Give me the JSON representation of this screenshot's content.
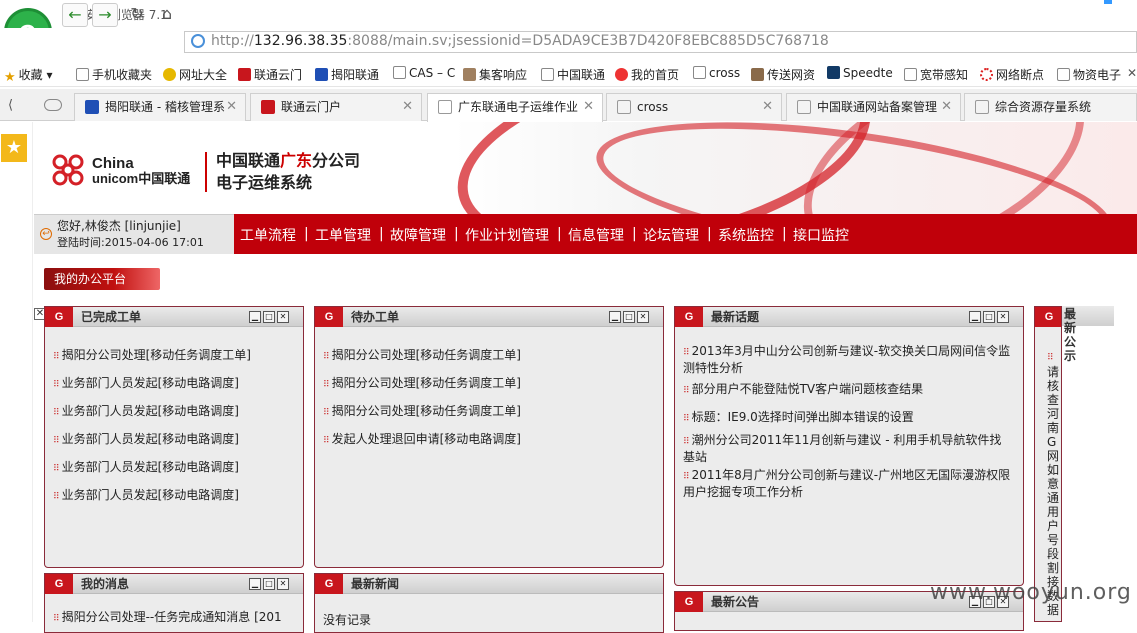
{
  "browser": {
    "app_title": "360安全浏览器 7.1",
    "url_prefix": "http://",
    "url_host": "132.96.38.35",
    "url_rest": ":8088/main.sv;jsessionid=D5ADA9CE3B7D420F8EBC885D5C768718"
  },
  "bookmarks": [
    {
      "label": "收藏",
      "icon": "star-icon"
    },
    {
      "label": "手机收藏夹",
      "icon": "page-icon"
    },
    {
      "label": "网址大全",
      "icon": "globe-icon"
    },
    {
      "label": "联通云门",
      "icon": "unicom-icon"
    },
    {
      "label": "揭阳联通",
      "icon": "unicom-icon"
    },
    {
      "label": "CAS – C",
      "icon": "page-icon"
    },
    {
      "label": "集客响应",
      "icon": "image-icon"
    },
    {
      "label": "中国联通",
      "icon": "page-icon"
    },
    {
      "label": "我的首页",
      "icon": "weibo-icon"
    },
    {
      "label": "cross",
      "icon": "page-icon"
    },
    {
      "label": "传送网资",
      "icon": "image-icon"
    },
    {
      "label": "Speedte",
      "icon": "speedtest-icon"
    },
    {
      "label": "宽带感知",
      "icon": "page-icon"
    },
    {
      "label": "网络断点",
      "icon": "spinner-icon"
    },
    {
      "label": "物资电子",
      "icon": "page-icon"
    }
  ],
  "tabs": [
    {
      "label": "揭阳联通 - 稽核管理系"
    },
    {
      "label": "联通云门户"
    },
    {
      "label": "广东联通电子运维作业"
    },
    {
      "label": "cross"
    },
    {
      "label": "中国联通网站备案管理"
    },
    {
      "label": "综合资源存量系统"
    }
  ],
  "header": {
    "brand_line1": "China",
    "brand_line2": "unicom中国联通",
    "title_part1": "中国联通",
    "title_red": "广东",
    "title_part2": "分公司",
    "title_line2": "电子运维系统"
  },
  "user": {
    "greeting": "您好,林俊杰 [linjunjie]",
    "login_time": "登陆时间:2015-04-06 17:01"
  },
  "menu": [
    "工单流程",
    "工单管理",
    "故障管理",
    "作业计划管理",
    "信息管理",
    "论坛管理",
    "系统监控",
    "接口监控"
  ],
  "office_label": "我的办公平台",
  "panels": {
    "completed": {
      "title": "已完成工单",
      "items": [
        "揭阳分公司处理[移动任务调度工单]",
        "业务部门人员发起[移动电路调度]",
        "业务部门人员发起[移动电路调度]",
        "业务部门人员发起[移动电路调度]",
        "业务部门人员发起[移动电路调度]",
        "业务部门人员发起[移动电路调度]"
      ]
    },
    "pending": {
      "title": "待办工单",
      "items": [
        "揭阳分公司处理[移动任务调度工单]",
        "揭阳分公司处理[移动任务调度工单]",
        "揭阳分公司处理[移动任务调度工单]",
        "发起人处理退回申请[移动电路调度]"
      ]
    },
    "topics": {
      "title": "最新话题",
      "items": [
        "2013年3月中山分公司创新与建议-软交换关口局网间信令监测特性分析",
        "部分用户不能登陆悦TV客户端问题核查结果",
        "标题：IE9.0选择时间弹出脚本错误的设置",
        "潮州分公司2011年11月创新与建议 - 利用手机导航软件找基站",
        "2011年8月广州分公司创新与建议-广州地区无国际漫游权限用户挖掘专项工作分析"
      ]
    },
    "notice": {
      "title": "最新公示",
      "text": "请核查河南G网如意通用户号段割接数据"
    },
    "messages": {
      "title": "我的消息",
      "items": [
        "揭阳分公司处理--任务完成通知消息 [201"
      ]
    },
    "news": {
      "title": "最新新闻",
      "items": [
        "没有记录"
      ]
    },
    "announcements": {
      "title": "最新公告"
    }
  },
  "watermark": "www.wooyun.org",
  "colors": {
    "brand_red": "#c0000a",
    "panel_border": "#8a2b3a"
  }
}
